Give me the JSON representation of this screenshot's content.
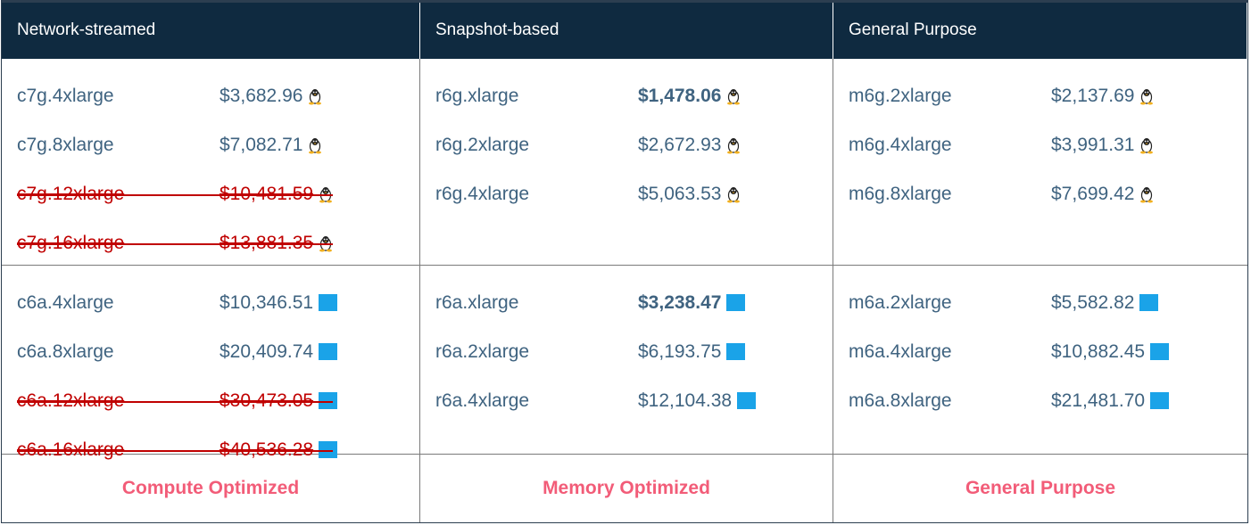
{
  "headers": [
    "Network-streamed",
    "Snapshot-based",
    "General Purpose"
  ],
  "graviton": {
    "compute": [
      {
        "name": "c7g.4xlarge",
        "price": "$3,682.96",
        "struck": false,
        "bold": false
      },
      {
        "name": "c7g.8xlarge",
        "price": "$7,082.71",
        "struck": false,
        "bold": false
      },
      {
        "name": "c7g.12xlarge",
        "price": "$10,481.59",
        "struck": true,
        "bold": false
      },
      {
        "name": "c7g.16xlarge",
        "price": "$13,881.35",
        "struck": true,
        "bold": false
      }
    ],
    "memory": [
      {
        "name": "r6g.xlarge",
        "price": "$1,478.06",
        "struck": false,
        "bold": true
      },
      {
        "name": "r6g.2xlarge",
        "price": "$2,672.93",
        "struck": false,
        "bold": false
      },
      {
        "name": "r6g.4xlarge",
        "price": "$5,063.53",
        "struck": false,
        "bold": false
      }
    ],
    "general": [
      {
        "name": "m6g.2xlarge",
        "price": "$2,137.69",
        "struck": false,
        "bold": false
      },
      {
        "name": "m6g.4xlarge",
        "price": "$3,991.31",
        "struck": false,
        "bold": false
      },
      {
        "name": "m6g.8xlarge",
        "price": "$7,699.42",
        "struck": false,
        "bold": false
      }
    ]
  },
  "amd": {
    "compute": [
      {
        "name": "c6a.4xlarge",
        "price": "$10,346.51",
        "struck": false,
        "bold": false
      },
      {
        "name": "c6a.8xlarge",
        "price": "$20,409.74",
        "struck": false,
        "bold": false
      },
      {
        "name": "c6a.12xlarge",
        "price": "$30,473.05",
        "struck": true,
        "bold": false
      },
      {
        "name": "c6a.16xlarge",
        "price": "$40,536.28",
        "struck": true,
        "bold": false
      }
    ],
    "memory": [
      {
        "name": "r6a.xlarge",
        "price": "$3,238.47",
        "struck": false,
        "bold": true
      },
      {
        "name": "r6a.2xlarge",
        "price": "$6,193.75",
        "struck": false,
        "bold": false
      },
      {
        "name": "r6a.4xlarge",
        "price": "$12,104.38",
        "struck": false,
        "bold": false
      }
    ],
    "general": [
      {
        "name": "m6a.2xlarge",
        "price": "$5,582.82",
        "struck": false,
        "bold": false
      },
      {
        "name": "m6a.4xlarge",
        "price": "$10,882.45",
        "struck": false,
        "bold": false
      },
      {
        "name": "m6a.8xlarge",
        "price": "$21,481.70",
        "struck": false,
        "bold": false
      }
    ]
  },
  "icons": {
    "graviton": "linux-icon",
    "amd": "windows-icon"
  },
  "footer": [
    "Compute Optimized",
    "Memory Optimized",
    "General Purpose"
  ],
  "colors": {
    "header_bg": "#0f2a40",
    "text": "#3f6380",
    "strike": "#c00000",
    "footer_text": "#f25c78",
    "windows_icon": "#1aa3e8"
  }
}
